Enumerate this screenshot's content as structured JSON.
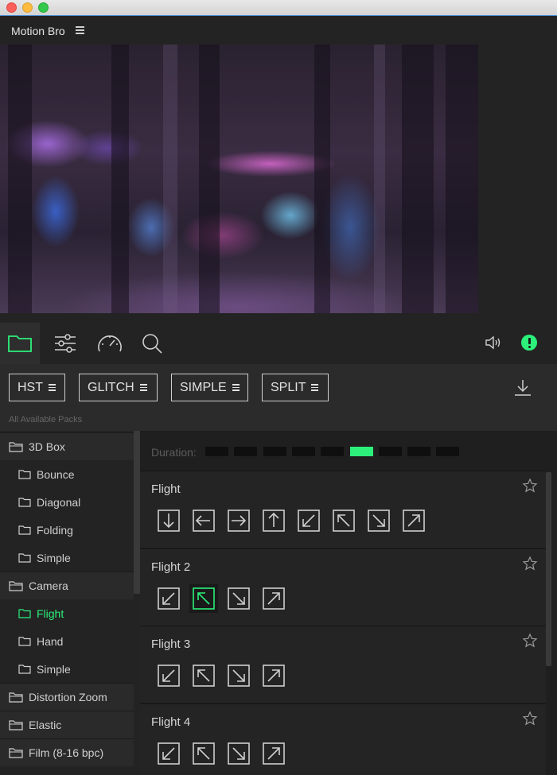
{
  "app": {
    "title": "Motion Bro"
  },
  "toolbar": {
    "tools": [
      "folder-icon",
      "sliders-icon",
      "speedometer-icon",
      "search-icon"
    ],
    "active_tool": "folder-icon"
  },
  "packs": {
    "items": [
      {
        "label": "HST",
        "active": true
      },
      {
        "label": "GLITCH",
        "active": false
      },
      {
        "label": "SIMPLE",
        "active": false
      },
      {
        "label": "SPLIT",
        "active": false
      }
    ],
    "all_label": "All Available Packs"
  },
  "sidebar": {
    "items": [
      {
        "label": "3D Box",
        "kind": "category"
      },
      {
        "label": "Bounce",
        "kind": "sub"
      },
      {
        "label": "Diagonal",
        "kind": "sub"
      },
      {
        "label": "Folding",
        "kind": "sub"
      },
      {
        "label": "Simple",
        "kind": "sub"
      },
      {
        "label": "Camera",
        "kind": "category"
      },
      {
        "label": "Flight",
        "kind": "sub",
        "selected": true
      },
      {
        "label": "Hand",
        "kind": "sub"
      },
      {
        "label": "Simple",
        "kind": "sub"
      },
      {
        "label": "Distortion Zoom",
        "kind": "category"
      },
      {
        "label": "Elastic",
        "kind": "category"
      },
      {
        "label": "Film (8-16 bpc)",
        "kind": "category"
      }
    ]
  },
  "duration": {
    "label": "Duration:",
    "segments": 9,
    "selected_index": 5
  },
  "groups": [
    {
      "title": "Flight",
      "arrows": [
        "down",
        "left",
        "right",
        "up",
        "down-left",
        "up-left",
        "down-right",
        "up-right"
      ]
    },
    {
      "title": "Flight 2",
      "arrows": [
        "down-left",
        "up-left",
        "down-right",
        "up-right"
      ],
      "selected_index": 1
    },
    {
      "title": "Flight 3",
      "arrows": [
        "down-left",
        "up-left",
        "down-right",
        "up-right"
      ]
    },
    {
      "title": "Flight 4",
      "arrows": [
        "down-left",
        "up-left",
        "down-right",
        "up-right"
      ]
    }
  ],
  "colors": {
    "accent": "#2cf07a",
    "background": "#232323",
    "panel": "#2b2b2b"
  }
}
